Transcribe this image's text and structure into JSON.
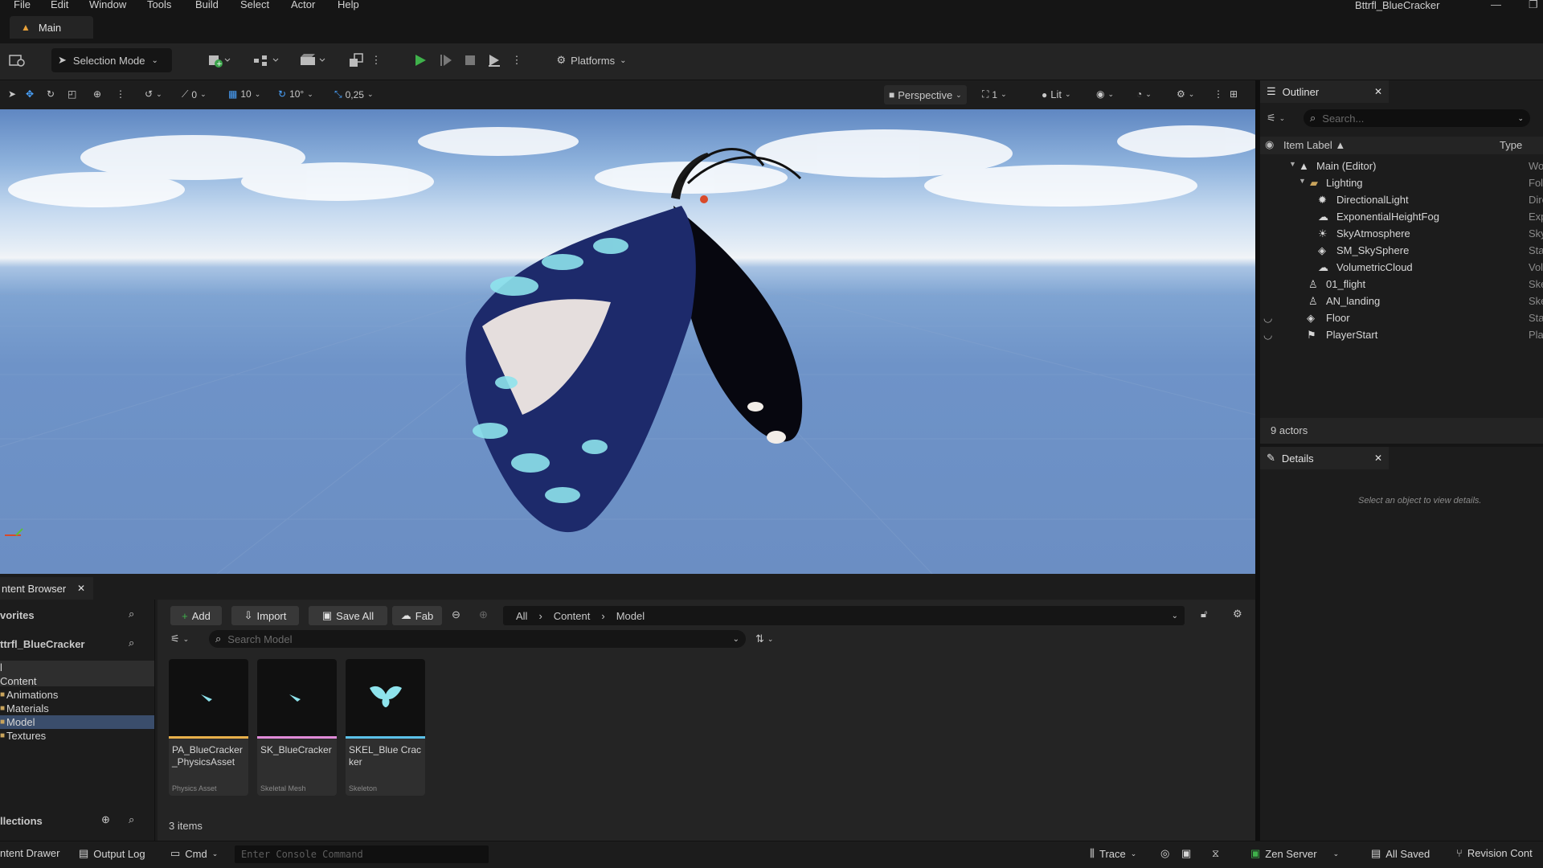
{
  "menu": [
    "File",
    "Edit",
    "Window",
    "Tools",
    "Build",
    "Select",
    "Actor",
    "Help"
  ],
  "app_title": "Bttrfl_BlueCracker",
  "tab": {
    "label": "Main"
  },
  "toolbar": {
    "selection_mode": "Selection Mode",
    "platforms": "Platforms"
  },
  "viewport_toolbar": {
    "rotate_snap": "0",
    "grid_snap": "10",
    "angle_snap": "10°",
    "scale_snap": "0,25",
    "perspective": "Perspective",
    "camera_speed": "1",
    "view_mode": "Lit"
  },
  "outliner": {
    "title": "Outliner",
    "search_placeholder": "Search...",
    "col_label": "Item Label ▲",
    "col_type": "Type",
    "rows": [
      {
        "label": "Main (Editor)",
        "type": "World"
      },
      {
        "label": "Lighting",
        "type": "Folder"
      },
      {
        "label": "DirectionalLight",
        "type": "Directio"
      },
      {
        "label": "ExponentialHeightFog",
        "type": "Exponen"
      },
      {
        "label": "SkyAtmosphere",
        "type": "SkyAtm"
      },
      {
        "label": "SM_SkySphere",
        "type": "StaticMe"
      },
      {
        "label": "VolumetricCloud",
        "type": "Volumet"
      },
      {
        "label": "01_flight",
        "type": "Skeletal"
      },
      {
        "label": "AN_landing",
        "type": "Skeletal"
      },
      {
        "label": "Floor",
        "type": "StaticMe"
      },
      {
        "label": "PlayerStart",
        "type": "PlayerSt"
      }
    ],
    "actor_count": "9 actors"
  },
  "details": {
    "title": "Details",
    "empty_text": "Select an object to view details."
  },
  "content_browser": {
    "tab_label": "ntent Browser",
    "favorites": "vorites",
    "project": "ttrfl_BlueCracker",
    "tree": [
      "l",
      "Content",
      "Animations",
      "Materials",
      "Model",
      "Textures"
    ],
    "collections": "llections",
    "add": "Add",
    "import": "Import",
    "save_all": "Save All",
    "fab": "Fab",
    "path": [
      "All",
      "Content",
      "Model"
    ],
    "search_placeholder": "Search Model",
    "assets": [
      {
        "name": "PA_BlueCracker _PhysicsAsset",
        "kind": "Physics Asset",
        "color": "#e8b04a"
      },
      {
        "name": "SK_BlueCracker",
        "kind": "Skeletal Mesh",
        "color": "#e08ad8"
      },
      {
        "name": "SKEL_Blue Cracker",
        "kind": "Skeleton",
        "color": "#5bc0e8"
      }
    ],
    "item_count": "3 items"
  },
  "statusbar": {
    "content_drawer": "ntent Drawer",
    "output_log": "Output Log",
    "cmd": "Cmd",
    "console_placeholder": "Enter Console Command",
    "trace": "Trace",
    "zen_server": "Zen Server",
    "all_saved": "All Saved",
    "revision": "Revision Cont"
  }
}
